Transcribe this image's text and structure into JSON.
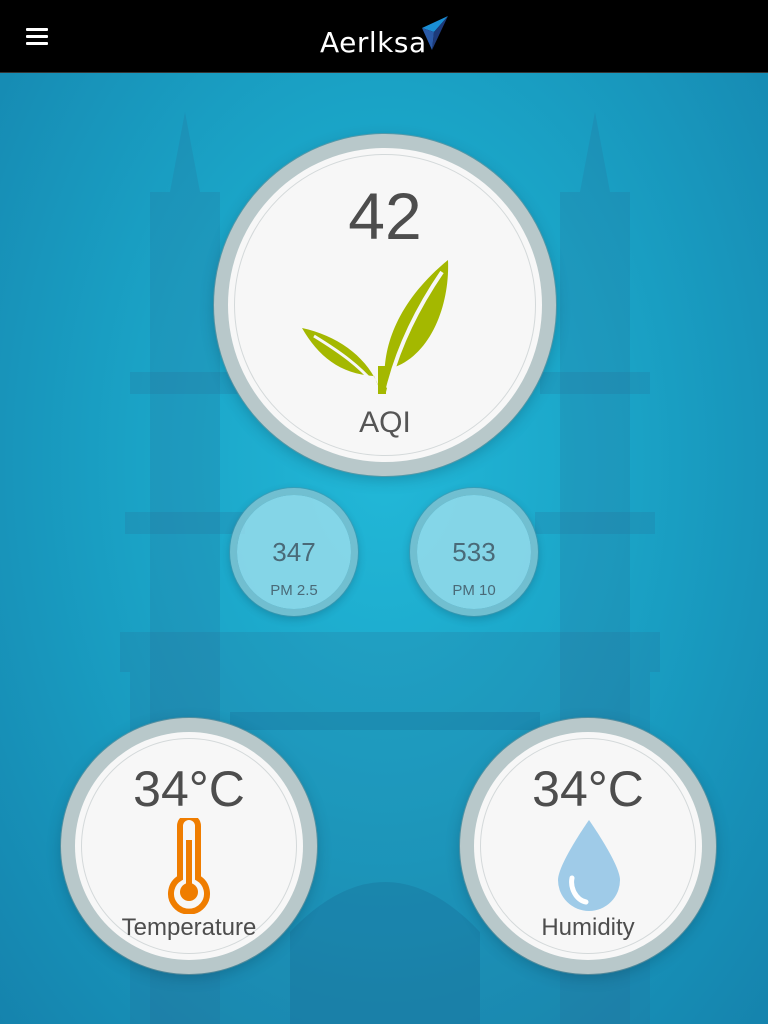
{
  "header": {
    "brand": "Aerlksa",
    "menu_icon": "hamburger-menu-icon",
    "logo_icon": "paper-plane-logo-icon"
  },
  "aqi": {
    "value": "42",
    "label": "AQI",
    "icon": "leaf-icon",
    "color": "#a4b800"
  },
  "particulates": [
    {
      "value": "347",
      "label": "PM 2.5"
    },
    {
      "value": "533",
      "label": "PM 10"
    }
  ],
  "temperature": {
    "value": "34°C",
    "label": "Temperature",
    "icon": "thermometer-icon",
    "color": "#ef7d00"
  },
  "humidity": {
    "value": "34°C",
    "label": "Humidity",
    "icon": "water-drop-icon",
    "color": "#9fcbe8"
  },
  "theme": {
    "background": "#1aa3c6",
    "topbar": "#000000"
  }
}
